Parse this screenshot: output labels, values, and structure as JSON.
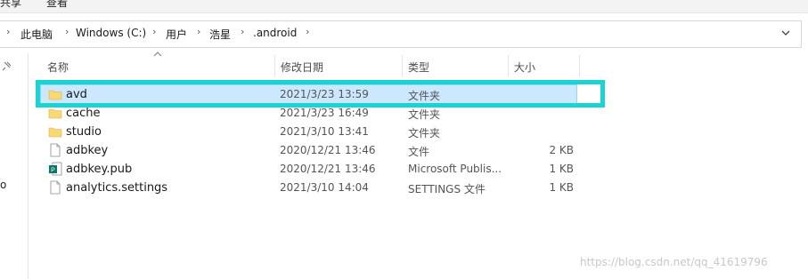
{
  "ribbon": {
    "tabs": [
      "共享",
      "查看"
    ]
  },
  "address": {
    "crumbs": [
      "此电脑",
      "Windows (C:)",
      "用户",
      "浩星",
      ".android"
    ]
  },
  "columns": {
    "name": "名称",
    "date": "修改日期",
    "type": "类型",
    "size": "大小"
  },
  "files": [
    {
      "name": "avd",
      "date": "2021/3/23 13:59",
      "type": "文件夹",
      "size": "",
      "icon": "folder-icon",
      "selected": true
    },
    {
      "name": "cache",
      "date": "2021/3/23 16:49",
      "type": "文件夹",
      "size": "",
      "icon": "folder-icon"
    },
    {
      "name": "studio",
      "date": "2021/3/10 13:41",
      "type": "文件夹",
      "size": "",
      "icon": "folder-icon"
    },
    {
      "name": "adbkey",
      "date": "2020/12/21 13:46",
      "type": "文件",
      "size": "2 KB",
      "icon": "file-icon"
    },
    {
      "name": "adbkey.pub",
      "date": "2020/12/21 13:46",
      "type": "Microsoft Publis...",
      "size": "1 KB",
      "icon": "publisher-file-icon"
    },
    {
      "name": "analytics.settings",
      "date": "2021/3/10 14:04",
      "type": "SETTINGS 文件",
      "size": "1 KB",
      "icon": "file-icon"
    }
  ],
  "nav": {
    "partial_label": "o"
  },
  "watermark": "https://blog.csdn.net/qq_41619796",
  "colors": {
    "selection": "#cce8ff",
    "highlight": "#1ad4d4",
    "folder": "#f8d775"
  }
}
